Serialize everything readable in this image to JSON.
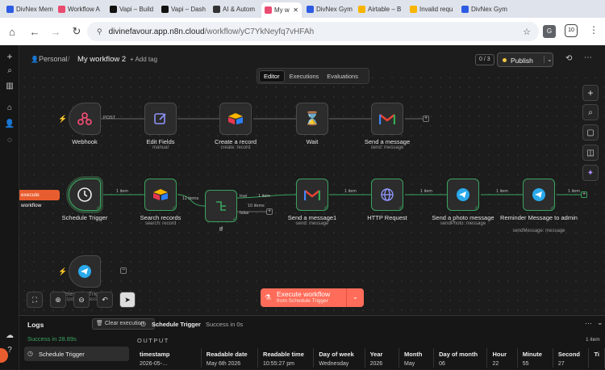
{
  "browser": {
    "tabs": [
      {
        "title": "DivNex Mem",
        "icon": "divnex-favicon",
        "color": "#2d5be3"
      },
      {
        "title": "Workflow A",
        "icon": "n8n-favicon",
        "color": "#ea4b71"
      },
      {
        "title": "Vapi – Build",
        "icon": "vapi-favicon",
        "color": "#111111"
      },
      {
        "title": "Vapi – Dash",
        "icon": "vapi-favicon",
        "color": "#111111"
      },
      {
        "title": "AI & Autom",
        "icon": "ai-favicon",
        "color": "#333333"
      },
      {
        "title": "My w",
        "icon": "n8n-favicon",
        "color": "#ea4b71"
      },
      {
        "title": "DivNex Gym",
        "icon": "divnex-favicon",
        "color": "#2d5be3"
      },
      {
        "title": "Airtable – B",
        "icon": "airtable-favicon",
        "color": "#f7b500"
      },
      {
        "title": "Invalid requ",
        "icon": "airtable-favicon",
        "color": "#f7b500"
      },
      {
        "title": "DivNex Gym",
        "icon": "divnex-favicon",
        "color": "#2d5be3"
      }
    ],
    "url_host": "divinefavour.app.n8n.cloud",
    "url_path": "/workflow/yC7YkNeyfq7vHFAh",
    "profile_badge": "10"
  },
  "topbar": {
    "project": "Personal",
    "separator": "/",
    "workflow_name": "My workflow 2",
    "add_tag": "+ Add tag",
    "version_counter": "0 / 3",
    "publish_label": "Publish"
  },
  "mode_tabs": [
    "Editor",
    "Executions",
    "Evaluations"
  ],
  "nodes": {
    "webhook": {
      "label": "Webhook",
      "sub": ""
    },
    "edit_fields": {
      "label": "Edit Fields",
      "sub": "manual"
    },
    "create_record": {
      "label": "Create a record",
      "sub": "create: record"
    },
    "wait": {
      "label": "Wait",
      "sub": ""
    },
    "send_message": {
      "label": "Send a message",
      "sub": "send: message"
    },
    "schedule_trigger": {
      "label": "Schedule Trigger",
      "sub": ""
    },
    "search_records": {
      "label": "Search records",
      "sub": "search: record"
    },
    "if_node": {
      "label": "If",
      "sub": ""
    },
    "send_message1": {
      "label": "Send a message1",
      "sub": "send: message"
    },
    "http_request": {
      "label": "HTTP Request",
      "sub": ""
    },
    "send_photo": {
      "label": "Send a photo message",
      "sub": "sendPhoto: message"
    },
    "reminder": {
      "label": "Reminder Message to admin",
      "sub": "sendMessage: message"
    },
    "telegram_trigger": {
      "label": "Telegram Trigger",
      "sub": "Updates: message"
    }
  },
  "edges": {
    "post": "POST",
    "one_item": "1 item",
    "eleven_items": "11 items",
    "ten_items": "10 items",
    "true": "true",
    "false": "false"
  },
  "execute_floating": "execute workflow",
  "execute_button": {
    "label": "Execute workflow",
    "sub": "from Schedule Trigger"
  },
  "logs": {
    "title": "Logs",
    "clear_label": "Clear execution",
    "success_text": "Success in 28.89s",
    "node_name": "Schedule Trigger",
    "node_status": "Success in 0s",
    "output_label": "OUTPUT",
    "item_count": "1 item",
    "selected_item": "Schedule Trigger",
    "columns": [
      "timestamp",
      "Readable date",
      "Readable time",
      "Day of week",
      "Year",
      "Month",
      "Day of month",
      "Hour",
      "Minute",
      "Second",
      "Ti"
    ],
    "row": [
      "2026-05-…",
      "May 6th 2026",
      "10:55:27 pm",
      "Wednesday",
      "2026",
      "May",
      "06",
      "22",
      "55",
      "27",
      ""
    ]
  },
  "colors": {
    "accent_orange": "#ff6d5a",
    "success_green": "#3aa35f",
    "publish_dot": "#f5c542",
    "gmail_red": "#ea4335",
    "airtable_blue": "#2d7ff9",
    "telegram_blue": "#29a9eb",
    "webhook_pink": "#ea4b71"
  }
}
